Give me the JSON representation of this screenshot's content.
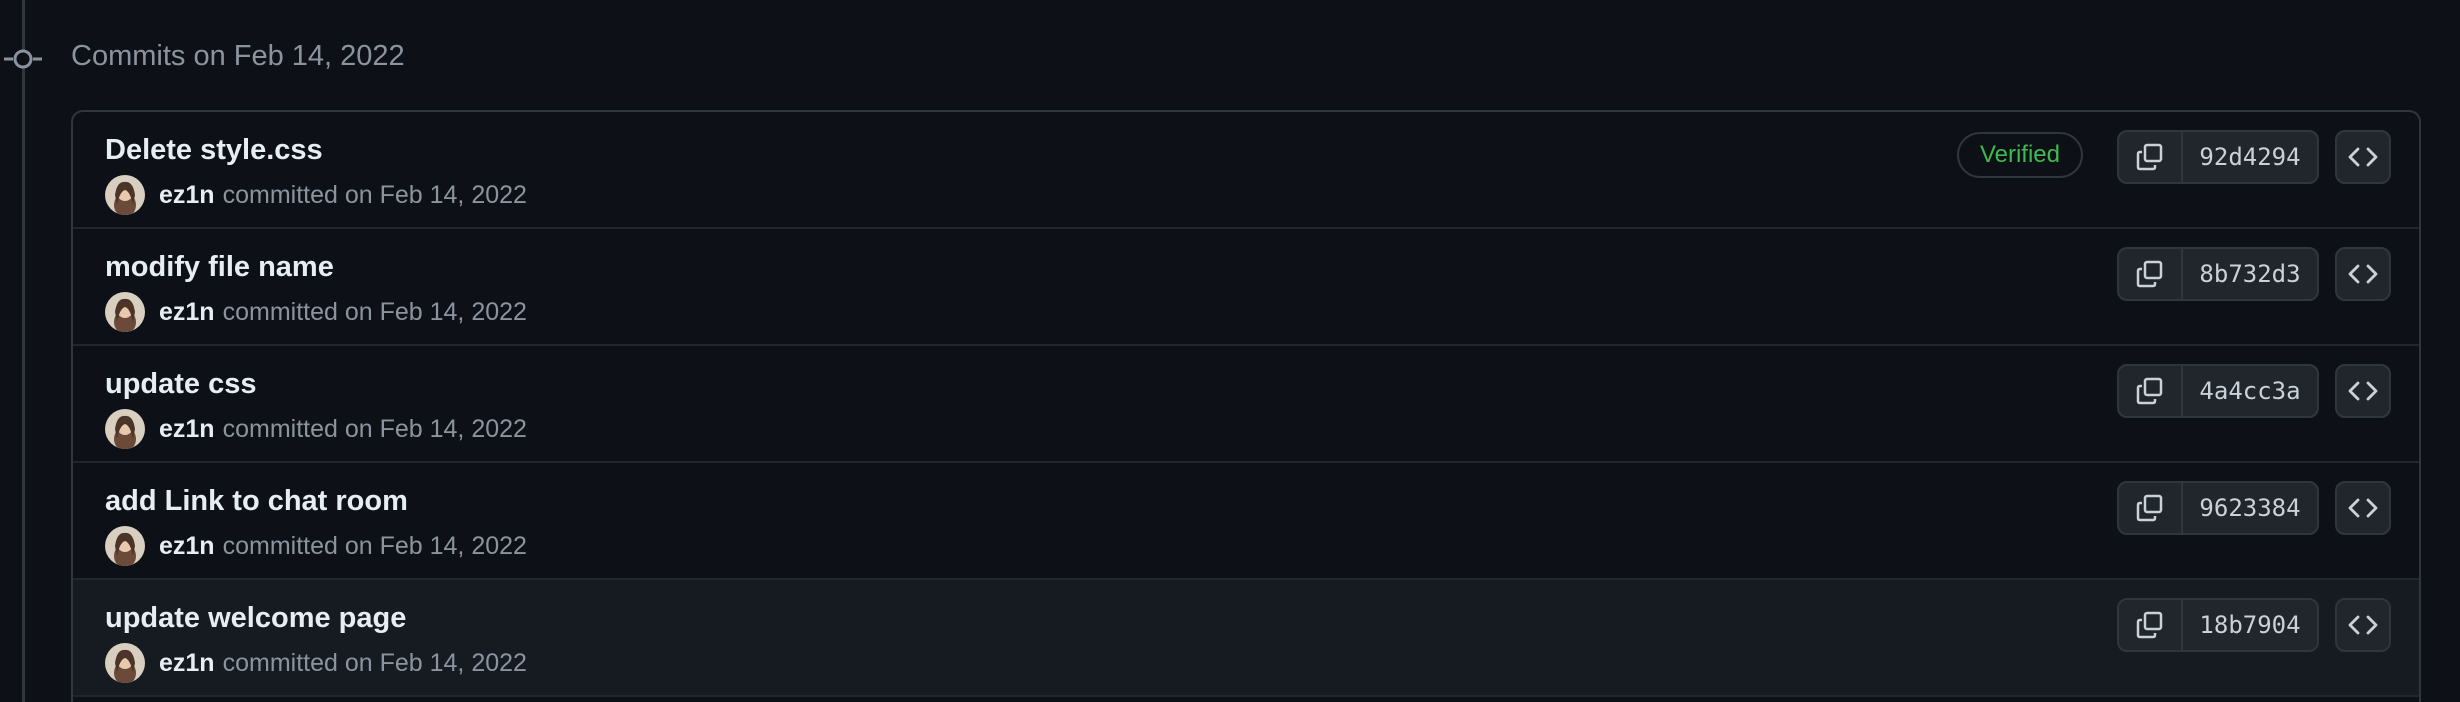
{
  "group": {
    "title": "Commits on Feb 14, 2022"
  },
  "commits": [
    {
      "message": "Delete style.css",
      "author": "ez1n",
      "meta": "committed on Feb 14, 2022",
      "badge": "Verified",
      "sha": "92d4294"
    },
    {
      "message": "modify file name",
      "author": "ez1n",
      "meta": "committed on Feb 14, 2022",
      "sha": "8b732d3"
    },
    {
      "message": "update css",
      "author": "ez1n",
      "meta": "committed on Feb 14, 2022",
      "sha": "4a4cc3a"
    },
    {
      "message": "add Link to chat room",
      "author": "ez1n",
      "meta": "committed on Feb 14, 2022",
      "sha": "9623384"
    },
    {
      "message": "update welcome page",
      "author": "ez1n",
      "meta": "committed on Feb 14, 2022",
      "sha": "18b7904"
    }
  ],
  "icons": {
    "timeline": "git-commit-icon",
    "copy": "copy-icon",
    "browse": "code-icon"
  },
  "colors": {
    "background": "#0d1117",
    "border": "#30363d",
    "verified": "#3fb950",
    "muted_text": "#8b949e"
  }
}
